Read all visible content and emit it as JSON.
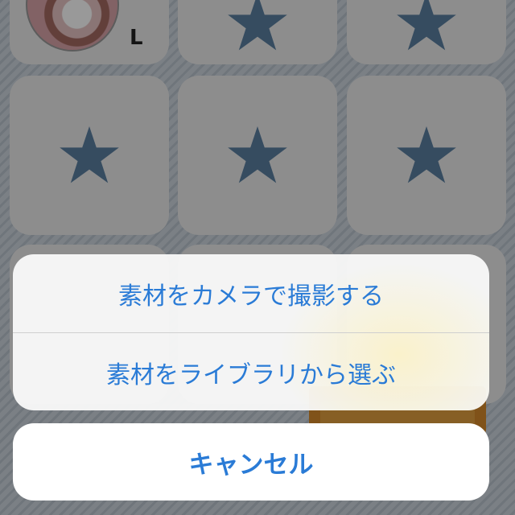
{
  "colors": {
    "accent": "#2a7bd6",
    "star": "#5a7fa1",
    "tile": "#ececec",
    "sheet": "#f8f8f8"
  },
  "avatar": {
    "letter": "L"
  },
  "grid": {
    "icon": "star-icon"
  },
  "action_sheet": {
    "camera_label": "素材をカメラで撮影する",
    "library_label": "素材をライブラリから選ぶ",
    "cancel_label": "キャンセル"
  }
}
